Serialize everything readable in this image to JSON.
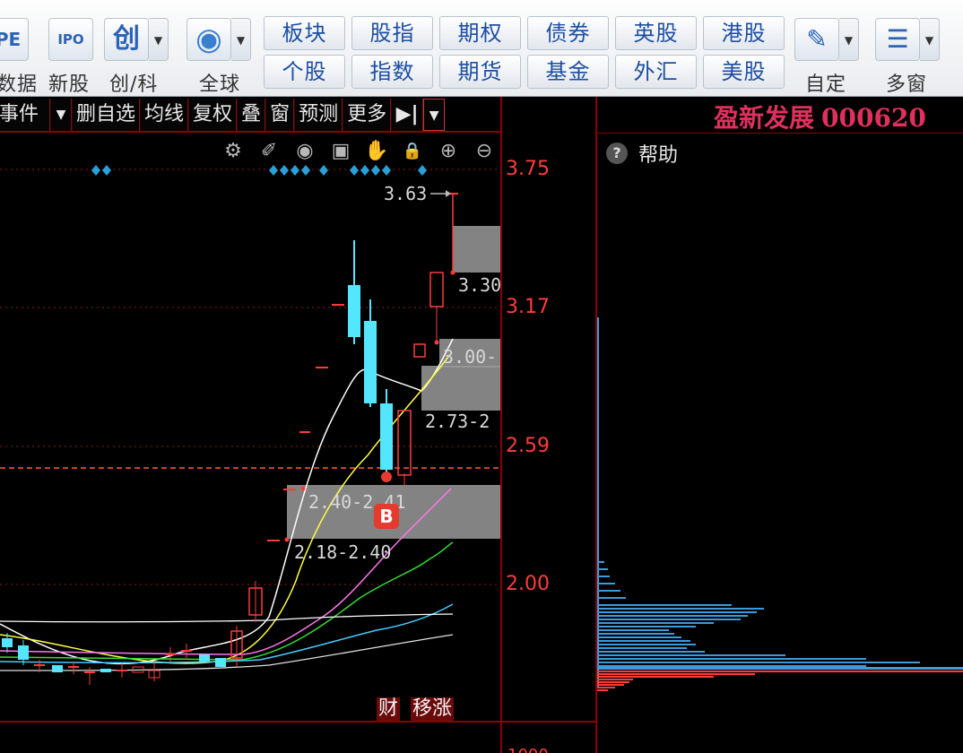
{
  "toolbar": {
    "big_buttons": [
      {
        "label": "数据",
        "icon": "pe-data-icon",
        "icon_text": "PE"
      },
      {
        "label": "新股",
        "icon": "ipo-icon",
        "icon_text": "IPO"
      },
      {
        "label": "创/科",
        "icon": "chuang-icon",
        "icon_text": "创"
      },
      {
        "label": "全球",
        "icon": "globe-icon",
        "icon_text": "◉"
      }
    ],
    "grid_buttons_top": [
      "板块",
      "股指",
      "期权",
      "债券",
      "英股",
      "港股"
    ],
    "grid_buttons_bottom": [
      "个股",
      "指数",
      "期货",
      "基金",
      "外汇",
      "美股"
    ],
    "right_buttons": [
      {
        "label": "自定",
        "icon": "custom-edit-icon",
        "icon_text": "✎"
      },
      {
        "label": "多窗",
        "icon": "multi-window-icon",
        "icon_text": "☰"
      }
    ]
  },
  "chart_menu": {
    "items": [
      "事件",
      "▼",
      "删自选",
      "均线",
      "复权",
      "叠",
      "窗",
      "预测",
      "更多",
      "▶|",
      "▼"
    ]
  },
  "tool_icons": [
    "gear-icon",
    "pen-icon",
    "eye-icon",
    "toolbox-icon",
    "hand-icon",
    "lock-icon",
    "zoom-in-icon",
    "zoom-out-icon"
  ],
  "tool_glyphs": [
    "⚙",
    "✐",
    "◉",
    "▣",
    "✋",
    "🔒",
    "⊕",
    "⊖"
  ],
  "price_axis": [
    "3.75",
    "3.17",
    "2.59",
    "2.00"
  ],
  "annotations": {
    "high_label": "3.63",
    "zone_labels": [
      "3.30",
      "3.00-",
      "2.73-2",
      "2.40-2.41",
      "2.18-2.40"
    ],
    "buy_badge": "B",
    "tag_cai": "财",
    "tag_zhang": "移涨"
  },
  "stock": {
    "name": "盈新发展",
    "code": "000620"
  },
  "info_panel": {
    "help_label": "帮助",
    "help_icon": "?"
  },
  "colors": {
    "up_candle": "#ff3b3b",
    "down_candle": "#55e6ff",
    "axis_red": "#ff3b3b",
    "title_pink": "#e0305e",
    "ma_white": "#ffffff",
    "ma_yellow": "#ffff44",
    "ma_magenta": "#ff77ee",
    "ma_green": "#33dd33",
    "ma_cyan": "#44ccff",
    "zone_gray": "#9a9a9a",
    "profile_blue": "#3b9bdd",
    "profile_red": "#ff3b3b"
  }
}
